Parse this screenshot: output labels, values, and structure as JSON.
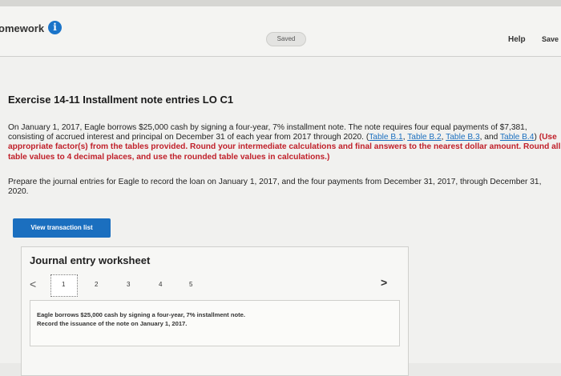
{
  "header": {
    "homework_label": "omework",
    "info_glyph": "i",
    "saved_label": "Saved",
    "help_label": "Help",
    "save_label": "Save"
  },
  "exercise": {
    "title": "Exercise 14-11 Installment note entries LO C1",
    "problem_text": "On January 1, 2017, Eagle borrows $25,000 cash by signing a four-year, 7% installment note. The note requires four equal payments of $7,381, consisting of accrued interest and principal on December 31 of each year from 2017 through 2020. (",
    "table_b1": "Table B.1",
    "sep1": ", ",
    "table_b2": "Table B.2",
    "sep2": ", ",
    "table_b3": "Table B.3",
    "sep3": ", and ",
    "table_b4": "Table B.4",
    "close_paren": ")",
    "instruction": "(Use appropriate factor(s) from the tables provided. Round your intermediate calculations and final answers to the nearest dollar amount. Round all table values to 4 decimal places, and use the rounded table values in calculations.)",
    "prepare_text": "Prepare the journal entries for Eagle to record the loan on January 1, 2017, and the four payments from December 31, 2017, through December 31, 2020."
  },
  "view_transaction_label": "View transaction list",
  "worksheet": {
    "title": "Journal entry worksheet",
    "pages": [
      "1",
      "2",
      "3",
      "4",
      "5"
    ],
    "active_page": 1,
    "prev_glyph": "<",
    "next_glyph": ">",
    "entry_line1": "Eagle borrows $25,000 cash by signing a four-year, 7% installment note.",
    "entry_line2": "Record the issuance of the note on January 1, 2017."
  },
  "colors": {
    "accent": "#1b6fbf",
    "instruction_red": "#c0202a"
  },
  "icons": {
    "info": "info-icon",
    "prev": "chevron-left-icon",
    "next": "chevron-right-icon"
  }
}
